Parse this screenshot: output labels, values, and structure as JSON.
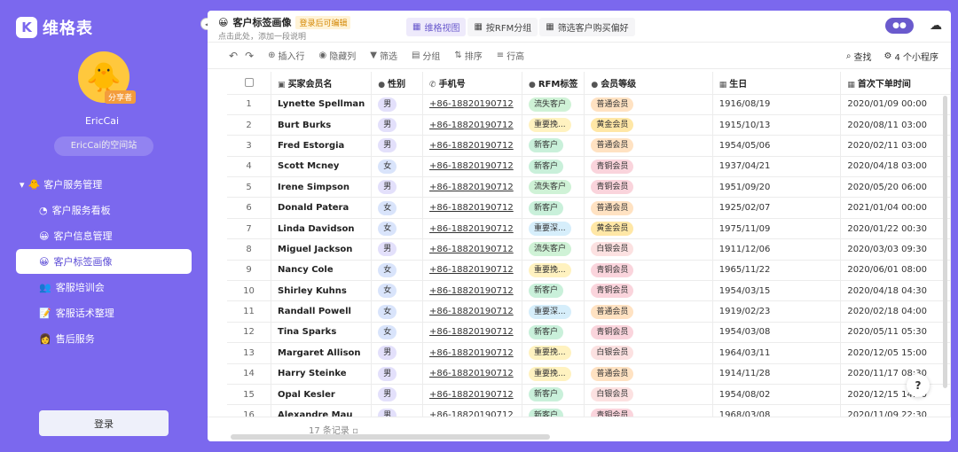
{
  "brand": {
    "name": "维格表",
    "logo_letter": "K"
  },
  "user": {
    "name": "EricCai",
    "badge": "分享者",
    "space": "EricCai的空间站",
    "avatar_icon": "🐥"
  },
  "nav": {
    "group_label": "客户服务管理",
    "group_icon": "🐥",
    "items": [
      {
        "label": "客户服务看板",
        "icon": "◔"
      },
      {
        "label": "客户信息管理",
        "icon": "😀"
      },
      {
        "label": "客户标签画像",
        "icon": "😀"
      },
      {
        "label": "客服培训会",
        "icon": "👥"
      },
      {
        "label": "客服话术整理",
        "icon": "📝"
      },
      {
        "label": "售后服务",
        "icon": "👩"
      }
    ]
  },
  "login_label": "登录",
  "sheet": {
    "title": "客户标签画像",
    "title_icon": "😀",
    "edit_badge": "登录后可编辑",
    "description": "点击此处，添加一段说明"
  },
  "view_tabs": [
    {
      "label": "维格视图",
      "icon": "▦"
    },
    {
      "label": "按RFM分组",
      "icon": "▦"
    },
    {
      "label": "筛选客户购买偏好",
      "icon": "▦"
    }
  ],
  "toolbar": {
    "undo_icon": "↶",
    "redo_icon": "↷",
    "insert_row": "插入行",
    "hide_columns": "隐藏列",
    "filter": "筛选",
    "group": "分组",
    "sort": "排序",
    "row_height": "行高",
    "find": "查找",
    "apps": "4 个小程序"
  },
  "columns": {
    "name": "买家会员名",
    "gender": "性别",
    "phone": "手机号",
    "rfm": "RFM标签",
    "level": "会员等级",
    "birthday": "生日",
    "first_order": "首次下单时间"
  },
  "colors": {
    "gender": {
      "男": "#E3E0FB",
      "女": "#D9E4FB"
    },
    "rfm": {
      "流失客户": "#CFF2D6",
      "重要挽...": "#FFF2C0",
      "新客户": "#C9F0DA",
      "重要深...": "#D6EEFB"
    },
    "level": {
      "普通会员": "#FFE2C2",
      "黄金会员": "#FFE7A6",
      "青铜会员": "#FAD4DC",
      "白银会员": "#FCE1E1"
    }
  },
  "rows": [
    {
      "no": "1",
      "name": "Lynette Spellman",
      "gender": "男",
      "phone": "+86-18820190712",
      "rfm": "流失客户",
      "level": "普通会员",
      "birthday": "1916/08/19",
      "first_order": "2020/01/09 00:00"
    },
    {
      "no": "2",
      "name": "Burt Burks",
      "gender": "男",
      "phone": "+86-18820190712",
      "rfm": "重要挽...",
      "level": "黄金会员",
      "birthday": "1915/10/13",
      "first_order": "2020/08/11 03:00"
    },
    {
      "no": "3",
      "name": "Fred Estorgia",
      "gender": "男",
      "phone": "+86-18820190712",
      "rfm": "新客户",
      "level": "普通会员",
      "birthday": "1954/05/06",
      "first_order": "2020/02/11 03:00"
    },
    {
      "no": "4",
      "name": "Scott Mcney",
      "gender": "女",
      "phone": "+86-18820190712",
      "rfm": "新客户",
      "level": "青铜会员",
      "birthday": "1937/04/21",
      "first_order": "2020/04/18 03:00"
    },
    {
      "no": "5",
      "name": "Irene Simpson",
      "gender": "男",
      "phone": "+86-18820190712",
      "rfm": "流失客户",
      "level": "青铜会员",
      "birthday": "1951/09/20",
      "first_order": "2020/05/20 06:00"
    },
    {
      "no": "6",
      "name": "Donald Patera",
      "gender": "女",
      "phone": "+86-18820190712",
      "rfm": "新客户",
      "level": "普通会员",
      "birthday": "1925/02/07",
      "first_order": "2021/01/04 00:00"
    },
    {
      "no": "7",
      "name": "Linda Davidson",
      "gender": "女",
      "phone": "+86-18820190712",
      "rfm": "重要深...",
      "level": "黄金会员",
      "birthday": "1975/11/09",
      "first_order": "2020/01/22 00:30"
    },
    {
      "no": "8",
      "name": "Miguel Jackson",
      "gender": "男",
      "phone": "+86-18820190712",
      "rfm": "流失客户",
      "level": "白银会员",
      "birthday": "1911/12/06",
      "first_order": "2020/03/03 09:30"
    },
    {
      "no": "9",
      "name": "Nancy Cole",
      "gender": "女",
      "phone": "+86-18820190712",
      "rfm": "重要挽...",
      "level": "青铜会员",
      "birthday": "1965/11/22",
      "first_order": "2020/06/01 08:00"
    },
    {
      "no": "10",
      "name": "Shirley Kuhns",
      "gender": "女",
      "phone": "+86-18820190712",
      "rfm": "新客户",
      "level": "青铜会员",
      "birthday": "1954/03/15",
      "first_order": "2020/04/18 04:30"
    },
    {
      "no": "11",
      "name": "Randall Powell",
      "gender": "女",
      "phone": "+86-18820190712",
      "rfm": "重要深...",
      "level": "普通会员",
      "birthday": "1919/02/23",
      "first_order": "2020/02/18 04:00"
    },
    {
      "no": "12",
      "name": "Tina Sparks",
      "gender": "女",
      "phone": "+86-18820190712",
      "rfm": "新客户",
      "level": "青铜会员",
      "birthday": "1954/03/08",
      "first_order": "2020/05/11 05:30"
    },
    {
      "no": "13",
      "name": "Margaret Allison",
      "gender": "男",
      "phone": "+86-18820190712",
      "rfm": "重要挽...",
      "level": "白银会员",
      "birthday": "1964/03/11",
      "first_order": "2020/12/05 15:00"
    },
    {
      "no": "14",
      "name": "Harry Steinke",
      "gender": "男",
      "phone": "+86-18820190712",
      "rfm": "重要挽...",
      "level": "普通会员",
      "birthday": "1914/11/28",
      "first_order": "2020/11/17 08:30"
    },
    {
      "no": "15",
      "name": "Opal Kesler",
      "gender": "男",
      "phone": "+86-18820190712",
      "rfm": "新客户",
      "level": "白银会员",
      "birthday": "1954/08/02",
      "first_order": "2020/12/15 14:00"
    },
    {
      "no": "16",
      "name": "Alexandre Mau",
      "gender": "男",
      "phone": "+86-18820190712",
      "rfm": "新客户",
      "level": "青铜会员",
      "birthday": "1968/03/08",
      "first_order": "2020/11/09 22:30"
    }
  ],
  "record_count": "17 条记录 ▫",
  "help_label": "?"
}
